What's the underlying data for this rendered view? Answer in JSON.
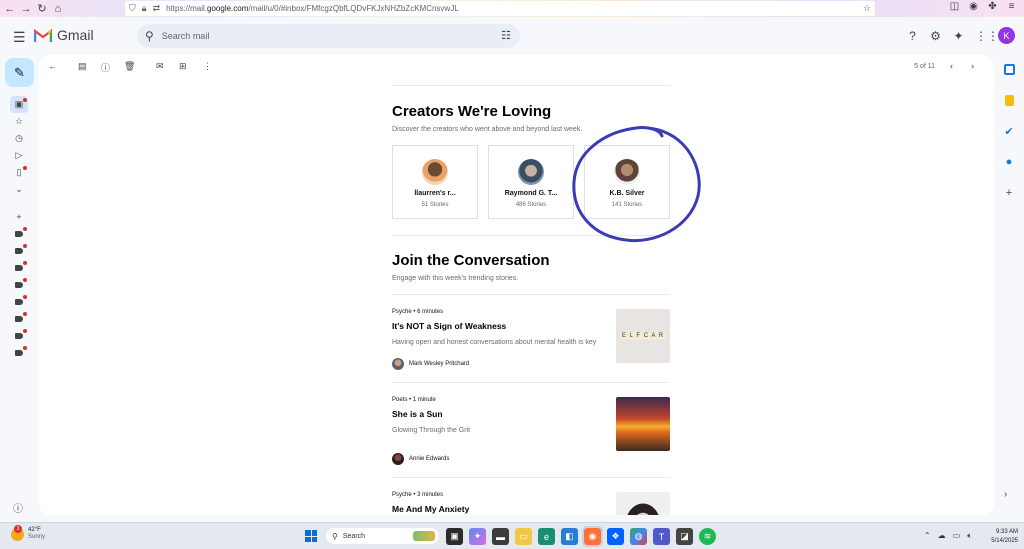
{
  "browser": {
    "url_prefix": "https://mail.",
    "url_domain": "google.com",
    "url_rest": "/mail/u/0/#inbox/FMfcgzQbfLQDvFKJxNHZbZcKMCnsvwJL"
  },
  "gmail": {
    "app_name": "Gmail",
    "search_placeholder": "Search mail",
    "avatar_letter": "K",
    "pager_text": "5 of 11"
  },
  "email": {
    "creators_title": "Creators We're Loving",
    "creators_subtitle": "Discover the creators who went above and beyond last week.",
    "creators": [
      {
        "name": "llaurren's r...",
        "stories": "51 Stories"
      },
      {
        "name": "Raymond G. T...",
        "stories": "486 Stories"
      },
      {
        "name": "K.B. Silver",
        "stories": "141 Stories"
      }
    ],
    "join_title": "Join the Conversation",
    "join_subtitle": "Engage with this week's trending stories.",
    "stories": [
      {
        "category": "Psyche • 6 minutes",
        "title": "It's NOT a Sign of Weakness",
        "description": "Having open and honest conversations about mental health is key",
        "author": "Mark Wesley Pritchard"
      },
      {
        "category": "Poets • 1 minute",
        "title": "She is a Sun",
        "description": "Glowing Through the Grit",
        "author": "Annie Edwards"
      },
      {
        "category": "Psyche • 3 minutes",
        "title": "Me And My Anxiety",
        "description": "",
        "author": ""
      }
    ],
    "thumb_letters": "E L F C A R"
  },
  "taskbar": {
    "temperature": "42°F",
    "condition": "Sunny",
    "weather_badge": "3",
    "search_label": "Search",
    "time": "9:33 AM",
    "date": "5/14/2025"
  },
  "colors": {
    "annotation_circle": "#3b3bb8",
    "gmail_red": "#ea4335",
    "compose_bg": "#c2e7ff",
    "avatar_bg": "#9334e6"
  }
}
